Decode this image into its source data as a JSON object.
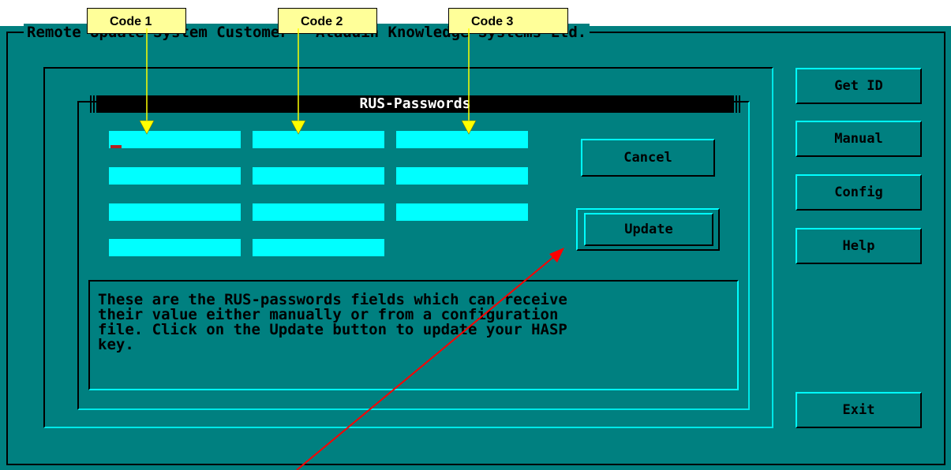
{
  "window": {
    "title": "Remote Update System Customer - Aladdin Knowledge Systems Ltd."
  },
  "dialog": {
    "title": "RUS-Passwords",
    "description_lines": [
      "These are the RUS-passwords fields which can receive",
      "their value either manually or from a configuration",
      "file. Click on the Update button to update your HASP",
      "key."
    ]
  },
  "fields": [
    {
      "value": ""
    },
    {
      "value": ""
    },
    {
      "value": ""
    },
    {
      "value": ""
    },
    {
      "value": ""
    },
    {
      "value": ""
    },
    {
      "value": ""
    },
    {
      "value": ""
    },
    {
      "value": ""
    },
    {
      "value": ""
    },
    {
      "value": ""
    }
  ],
  "dialog_buttons": {
    "cancel": "Cancel",
    "update": "Update"
  },
  "side_buttons": {
    "get_id": "Get ID",
    "manual": "Manual",
    "config": "Config",
    "help": "Help",
    "exit": "Exit"
  },
  "annotations": {
    "code1": "Code 1",
    "code2": "Code 2",
    "code3": "Code 3"
  },
  "colors": {
    "background": "#008080",
    "field": "#00ffff",
    "label": "#ffff99",
    "pointer_arrow": "#ff0000",
    "code_arrow": "#ffff00"
  }
}
